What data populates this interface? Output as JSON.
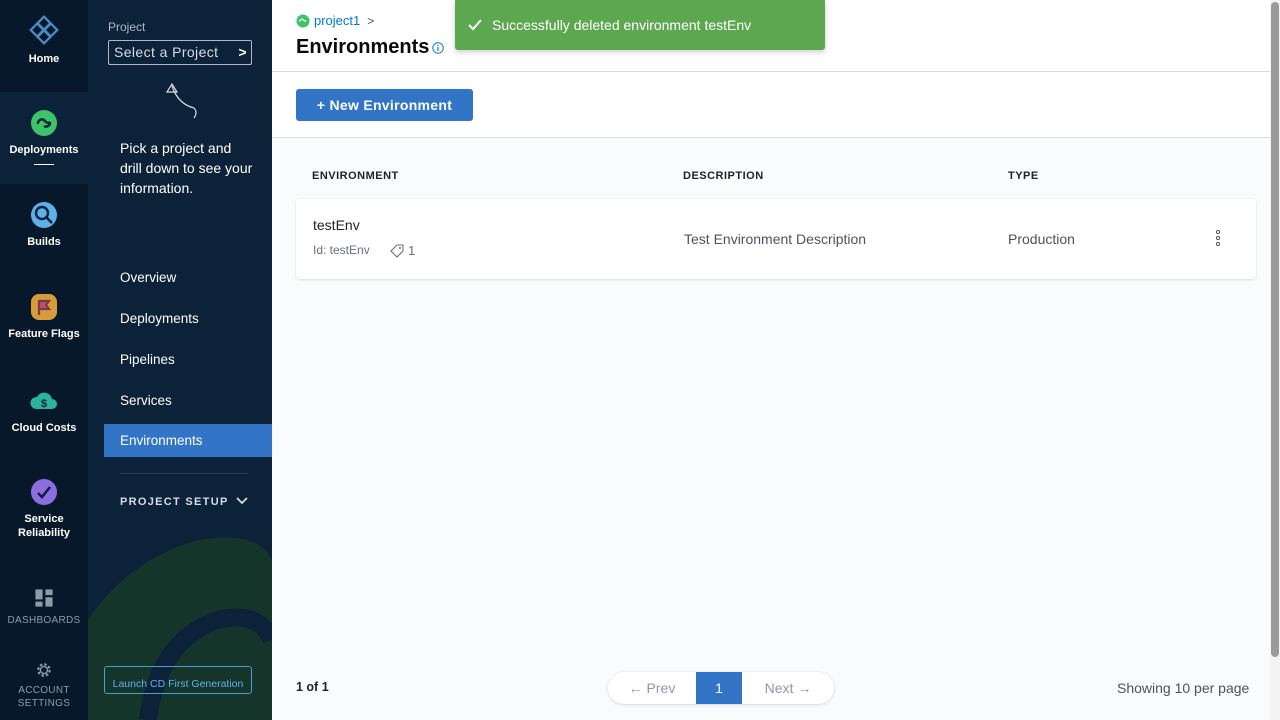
{
  "rail": {
    "items": [
      {
        "label": "Home",
        "icon": "harness-logo-icon"
      },
      {
        "label": "Deployments",
        "icon": "deployments-icon",
        "active": true
      },
      {
        "label": "Builds",
        "icon": "builds-icon"
      },
      {
        "label": "Feature Flags",
        "icon": "feature-flags-icon"
      },
      {
        "label": "Cloud Costs",
        "icon": "cloud-costs-icon"
      },
      {
        "label": "Service\nReliability",
        "icon": "service-reliability-icon"
      },
      {
        "label": "DASHBOARDS",
        "icon": "dashboards-icon"
      },
      {
        "label": "ACCOUNT\nSETTINGS",
        "icon": "gear-icon"
      }
    ]
  },
  "nav": {
    "project_label": "Project",
    "project_select": "Select a Project",
    "pick_text": "Pick a project and drill down to see your information.",
    "links": [
      "Overview",
      "Deployments",
      "Pipelines",
      "Services",
      "Environments"
    ],
    "active_link": "Environments",
    "project_setup": "PROJECT SETUP",
    "launch_button": "Launch CD First Generation"
  },
  "header": {
    "breadcrumb": "project1",
    "title": "Environments"
  },
  "toolbar": {
    "new_button": "+ New Environment"
  },
  "table": {
    "columns": [
      "ENVIRONMENT",
      "DESCRIPTION",
      "TYPE"
    ],
    "rows": [
      {
        "name": "testEnv",
        "id_text": "Id: testEnv",
        "tag_count": "1",
        "description": "Test Environment Description",
        "type": "Production"
      }
    ]
  },
  "pagination": {
    "page_info": "1 of 1",
    "prev": "Prev",
    "current_page": "1",
    "next": "Next",
    "per_page": "Showing 10 per page"
  },
  "toast": {
    "message": "Successfully deleted environment testEnv"
  },
  "colors": {
    "rail_bg": "#07182b",
    "nav_bg": "#0b2239",
    "primary": "#3274c5",
    "success": "#5ca750"
  }
}
